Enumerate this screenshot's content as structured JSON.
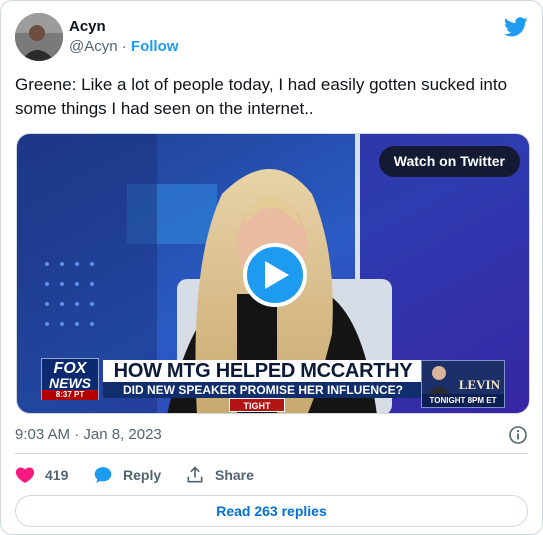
{
  "author": {
    "display_name": "Acyn",
    "handle": "@Acyn",
    "separator": "·",
    "follow_label": "Follow"
  },
  "tweet": {
    "text": "Greene: Like a lot of people today, I had easily gotten sucked into some things I had seen on the internet..",
    "timestamp": "9:03 AM · Jan 8, 2023"
  },
  "media": {
    "watch_label": "Watch on Twitter",
    "chyron_headline": "HOW MTG HELPED MCCARTHY WIN",
    "chyron_subline": "DID NEW SPEAKER PROMISE HER INFLUENCE?",
    "chyron_segment": "TIGHT SHOT",
    "network_logo_line1": "FOX",
    "network_logo_line2": "NEWS",
    "network_time": "8:37 PT",
    "promo_name": "LEVIN",
    "promo_time": "TONIGHT 8PM ET"
  },
  "actions": {
    "likes_count": "419",
    "reply_label": "Reply",
    "share_label": "Share"
  },
  "replies_button": "Read 263 replies",
  "colors": {
    "accent": "#1d9bf0",
    "like": "#f91880",
    "text_secondary": "#536471"
  }
}
